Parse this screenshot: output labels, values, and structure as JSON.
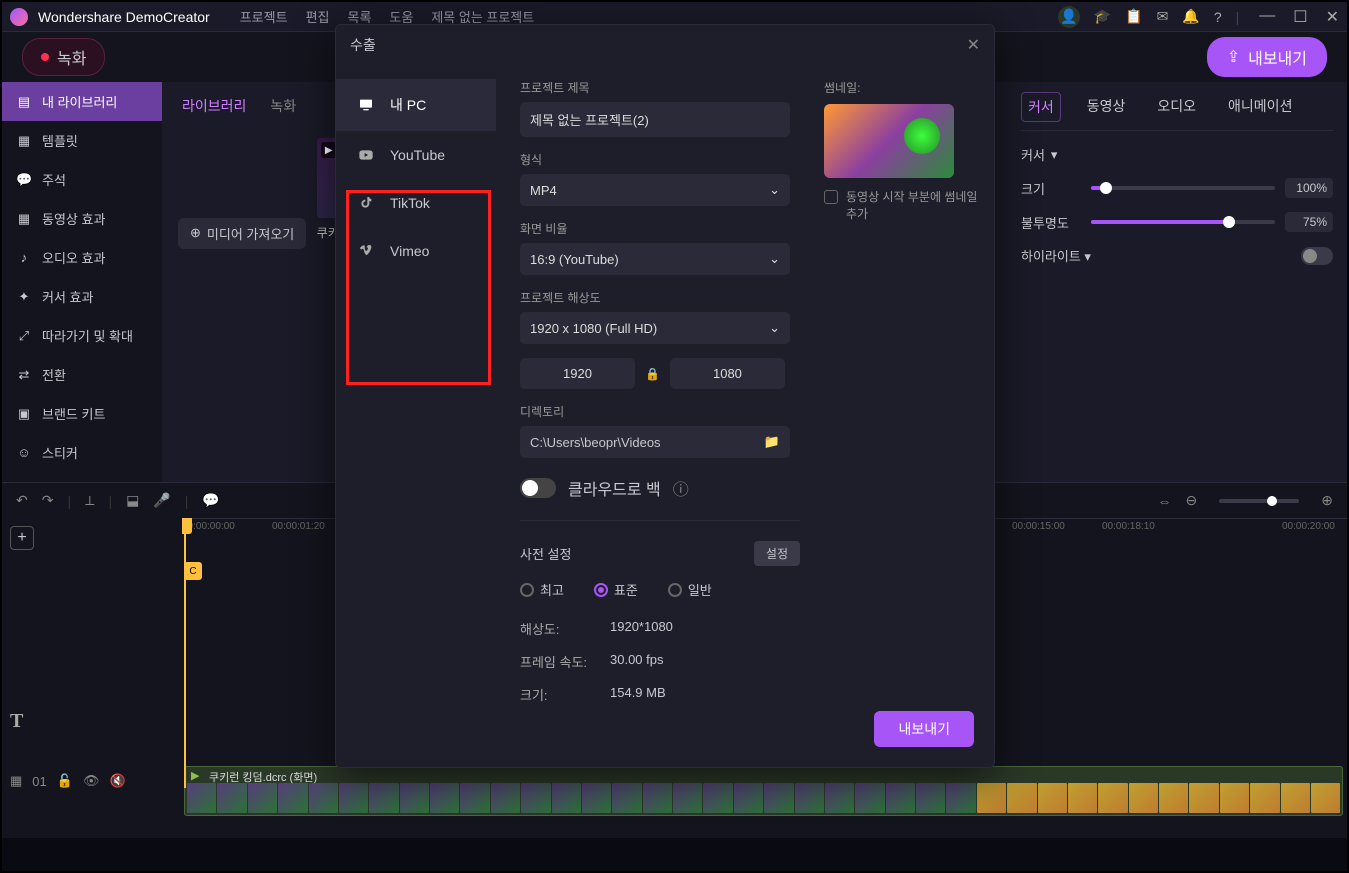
{
  "app": {
    "title": "Wondershare DemoCreator"
  },
  "menu": [
    "프로젝트",
    "편집",
    "목록",
    "도움",
    "제목 없는 프로젝트"
  ],
  "toolbar": {
    "record": "녹화",
    "export": "내보내기"
  },
  "sidebar": {
    "items": [
      {
        "icon": "▤",
        "label": "내 라이브러리"
      },
      {
        "icon": "▦",
        "label": "템플릿"
      },
      {
        "icon": "💬",
        "label": "주석"
      },
      {
        "icon": "▦",
        "label": "동영상 효과"
      },
      {
        "icon": "♪",
        "label": "오디오 효과"
      },
      {
        "icon": "✦",
        "label": "커서 효과"
      },
      {
        "icon": "⤢",
        "label": "따라가기 및 확대"
      },
      {
        "icon": "⇄",
        "label": "전환"
      },
      {
        "icon": "▣",
        "label": "브랜드 키트"
      },
      {
        "icon": "☺",
        "label": "스티커"
      }
    ]
  },
  "library": {
    "tabs": [
      "라이브러리",
      "녹화"
    ],
    "import": "미디어 가져오기",
    "clipName": "쿠키런 킹덤.dcrc"
  },
  "rightPanel": {
    "tabs": [
      "커서",
      "동영상",
      "오디오",
      "애니메이션"
    ],
    "cursorHeading": "커서",
    "size": {
      "label": "크기",
      "value": "100%",
      "fill": 8
    },
    "opacity": {
      "label": "불투명도",
      "value": "75%",
      "fill": 75
    },
    "highlight": "하이라이트"
  },
  "modal": {
    "title": "수출",
    "nav": [
      {
        "icon": "pc",
        "label": "내 PC"
      },
      {
        "icon": "yt",
        "label": "YouTube"
      },
      {
        "icon": "tt",
        "label": "TikTok"
      },
      {
        "icon": "vm",
        "label": "Vimeo"
      }
    ],
    "projectTitleLabel": "프로젝트 제목",
    "projectTitle": "제목 없는 프로젝트(2)",
    "formatLabel": "형식",
    "format": "MP4",
    "aspectLabel": "화면 비율",
    "aspect": "16:9 (YouTube)",
    "resLabel": "프로젝트 해상도",
    "res": "1920 x 1080 (Full HD)",
    "width": "1920",
    "height": "1080",
    "dirLabel": "디렉토리",
    "dir": "C:\\Users\\beopr\\Videos",
    "cloudLabel": "클라우드로 백",
    "thumbLabel": "썸네일:",
    "thumbCheck": "동영상 시작 부분에 썸네일 추가",
    "presetLabel": "사전 설정",
    "settingsBtn": "설정",
    "presets": {
      "best": "최고",
      "standard": "표준",
      "normal": "일반"
    },
    "resolutionK": "해상도:",
    "resolutionV": "1920*1080",
    "fpsK": "프레임 속도:",
    "fpsV": "30.00 fps",
    "sizeK": "크기:",
    "sizeV": "154.9 MB",
    "exportBtn": "내보내기"
  },
  "timeline": {
    "ticks": [
      "00:00:00:00",
      "00:00:01:20",
      "00:00:15:00",
      "00:00:18:10",
      "00:00:20:00"
    ],
    "trackCount": "01",
    "clipLabel": "쿠키런 킹덤.dcrc (화면)",
    "markerText": "C"
  }
}
